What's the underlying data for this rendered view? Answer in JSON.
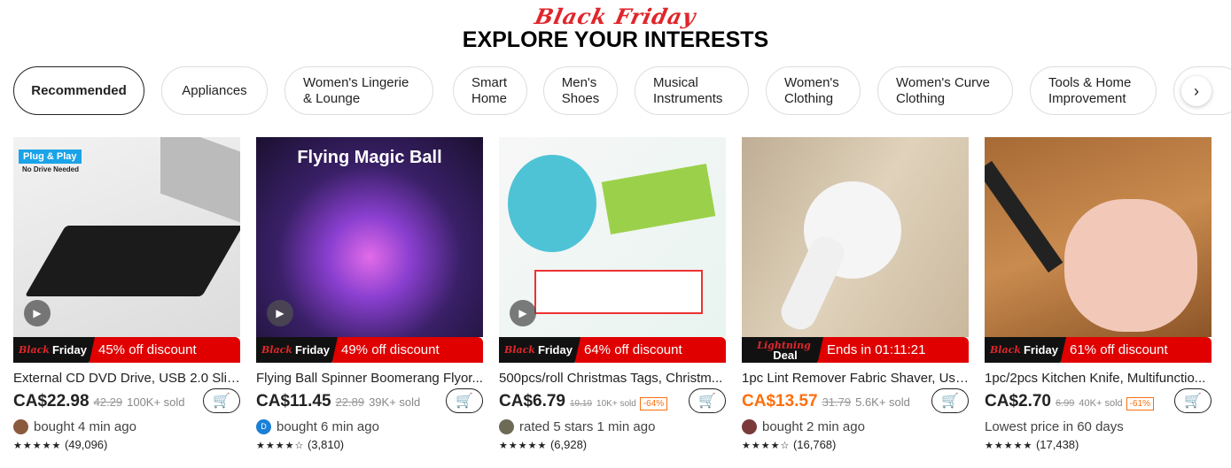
{
  "header": {
    "promo": "Black Friday",
    "title": "EXPLORE YOUR INTERESTS"
  },
  "categories": [
    {
      "label": "Recommended",
      "active": true
    },
    {
      "label": "Appliances"
    },
    {
      "label": "Women's Lingerie & Lounge"
    },
    {
      "label": "Smart Home"
    },
    {
      "label": "Men's Shoes"
    },
    {
      "label": "Musical Instruments"
    },
    {
      "label": "Women's Clothing"
    },
    {
      "label": "Women's Curve Clothing"
    },
    {
      "label": "Tools & Home Improvement"
    }
  ],
  "next_icon": "chevron-right-icon",
  "colors": {
    "accent": "#e00000",
    "orange": "#fd6f0f"
  },
  "products": [
    {
      "image_text": "Plug & Play",
      "image_sub": "No Drive Needed",
      "banner_left_a": "Black",
      "banner_left_b": "Friday",
      "banner": "45% off discount",
      "name": "External CD DVD Drive, USB 2.0 Slim...",
      "price": "CA$22.98",
      "old": "42.29",
      "sold": "100K+ sold",
      "discount": "",
      "activity": "bought 4 min ago",
      "rating": 5,
      "stars": "★★★★★",
      "reviews": "(49,096)"
    },
    {
      "image_text": "Flying Magic Ball",
      "banner_left_a": "Black",
      "banner_left_b": "Friday",
      "banner": "49% off discount",
      "name": "Flying Ball Spinner Boomerang Flyor...",
      "price": "CA$11.45",
      "old": "22.89",
      "sold": "39K+ sold",
      "discount": "",
      "avatar_letter": "D",
      "activity": "bought 6 min ago",
      "rating": 4.5,
      "stars": "★★★★☆",
      "reviews": "(3,810)"
    },
    {
      "banner_left_a": "Black",
      "banner_left_b": "Friday",
      "banner": "64% off discount",
      "name": "500pcs/roll Christmas Tags, Christm...",
      "price": "CA$6.79",
      "old": "19.19",
      "sold": "10K+ sold",
      "discount": "-64%",
      "activity": "rated 5 stars 1 min ago",
      "rating": 5,
      "stars": "★★★★★",
      "reviews": "(6,928)"
    },
    {
      "banner_left_a": "Lightning",
      "banner_left_b": "Deal",
      "banner": "Ends in 01:11:21",
      "name": "1pc Lint Remover Fabric Shaver, Usb...",
      "price": "CA$13.57",
      "old": "31.79",
      "sold": "5.6K+ sold",
      "discount": "",
      "activity": "bought 2 min ago",
      "rating": 4.5,
      "stars": "★★★★☆",
      "reviews": "(16,768)"
    },
    {
      "banner_left_a": "Black",
      "banner_left_b": "Friday",
      "banner": "61% off discount",
      "name": "1pc/2pcs Kitchen Knife, Multifunctio...",
      "price": "CA$2.70",
      "old": "6.99",
      "sold": "40K+ sold",
      "discount": "-61%",
      "activity": "Lowest price in 60 days",
      "rating": 5,
      "stars": "★★★★★",
      "reviews": "(17,438)"
    }
  ]
}
